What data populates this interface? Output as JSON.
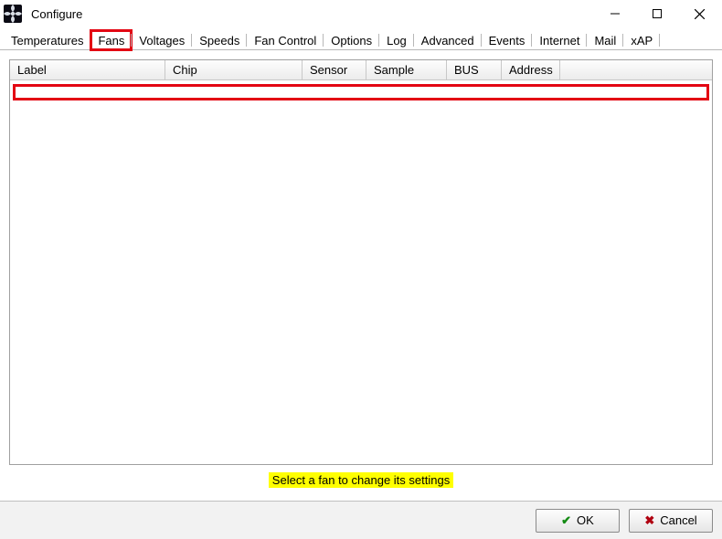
{
  "window": {
    "title": "Configure"
  },
  "tabs": {
    "items": [
      {
        "label": "Temperatures"
      },
      {
        "label": "Fans"
      },
      {
        "label": "Voltages"
      },
      {
        "label": "Speeds"
      },
      {
        "label": "Fan Control"
      },
      {
        "label": "Options"
      },
      {
        "label": "Log"
      },
      {
        "label": "Advanced"
      },
      {
        "label": "Events"
      },
      {
        "label": "Internet"
      },
      {
        "label": "Mail"
      },
      {
        "label": "xAP"
      }
    ],
    "active_index": 1,
    "highlighted_index": 1
  },
  "list": {
    "columns": [
      {
        "label": "Label"
      },
      {
        "label": "Chip"
      },
      {
        "label": "Sensor"
      },
      {
        "label": "Sample"
      },
      {
        "label": "BUS"
      },
      {
        "label": "Address"
      }
    ],
    "rows": []
  },
  "hint": "Select a fan to change its settings",
  "buttons": {
    "ok": "OK",
    "cancel": "Cancel"
  }
}
